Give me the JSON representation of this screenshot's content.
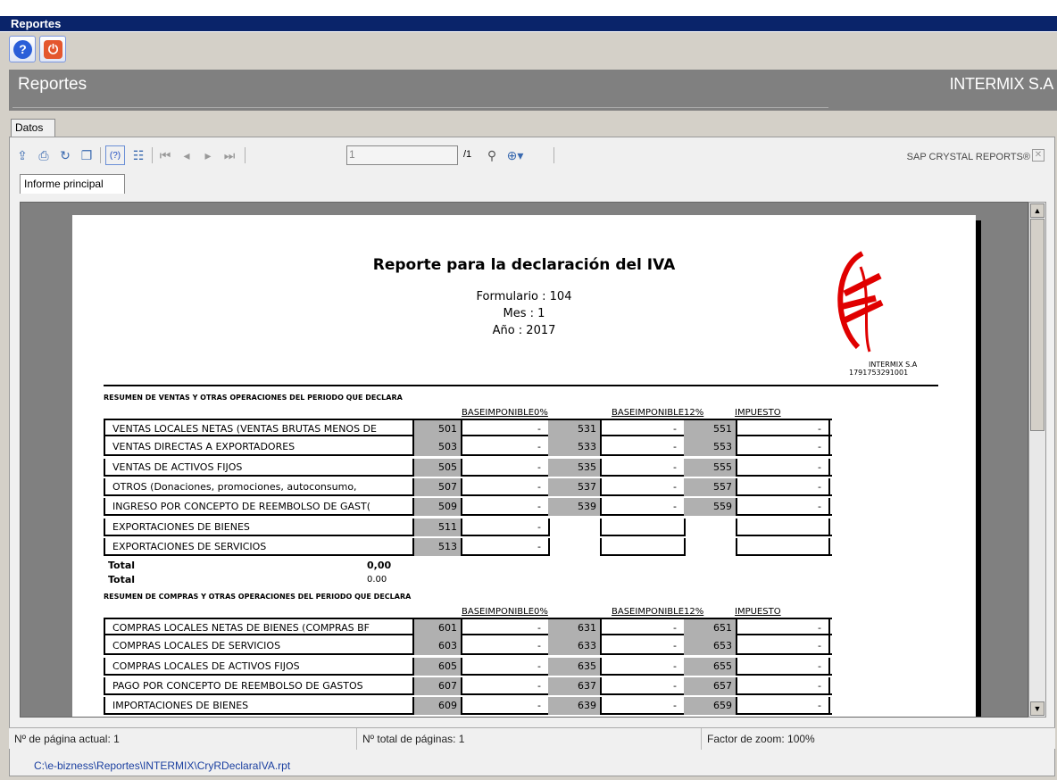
{
  "window": {
    "title": "Reportes"
  },
  "header": {
    "title": "Reportes",
    "company": "INTERMIX S.A"
  },
  "tabs": {
    "datos": "Datos",
    "main_report": "Informe principal"
  },
  "toolbar": {
    "page_value": "1",
    "page_total": "/1",
    "brand": "SAP CRYSTAL REPORTS®",
    "icons": [
      "export-icon",
      "print-icon",
      "refresh-icon",
      "copy-icon",
      "help-icon",
      "group-tree-icon",
      "first-page-icon",
      "prev-page-icon",
      "next-page-icon",
      "last-page-icon",
      "search-icon",
      "zoom-icon"
    ]
  },
  "report": {
    "title": "Reporte para la declaración del IVA",
    "form": "Formulario : 104",
    "month": "Mes : 1",
    "year": "Año : 2017",
    "logo_company": "INTERMIX S.A",
    "logo_ruc": "1791753291001",
    "sales_section": "RESUMEN DE VENTAS Y OTRAS OPERACIONES DEL PERIODO QUE DECLARA",
    "purchase_section": "RESUMEN DE COMPRAS Y OTRAS OPERACIONES DEL PERIODO QUE DECLARA",
    "col_base0": "BASEIMPONIBLE0%",
    "col_base12": "BASEIMPONIBLE12%",
    "col_tax": "IMPUESTO",
    "total_label_1": "Total",
    "total_value_1": "0,00",
    "total_label_2": "Total",
    "total_value_2": "0.00",
    "sales_rows": [
      {
        "label": "VENTAS LOCALES NETAS (VENTAS BRUTAS MENOS DE",
        "c1": "501",
        "v1": "-",
        "c2": "531",
        "v2": "-",
        "c3": "551",
        "v3": "-"
      },
      {
        "label": "VENTAS DIRECTAS A EXPORTADORES",
        "c1": "503",
        "v1": "-",
        "c2": "533",
        "v2": "-",
        "c3": "553",
        "v3": "-"
      },
      {
        "label": "VENTAS DE ACTIVOS FIJOS",
        "c1": "505",
        "v1": "-",
        "c2": "535",
        "v2": "-",
        "c3": "555",
        "v3": "-"
      },
      {
        "label": "OTROS (Donaciones, promociones, autoconsumo,",
        "c1": "507",
        "v1": "-",
        "c2": "537",
        "v2": "-",
        "c3": "557",
        "v3": "-"
      },
      {
        "label": "INGRESO POR CONCEPTO DE REEMBOLSO DE GAST(",
        "c1": "509",
        "v1": "-",
        "c2": "539",
        "v2": "-",
        "c3": "559",
        "v3": "-"
      },
      {
        "label": "EXPORTACIONES DE BIENES",
        "c1": "511",
        "v1": "-",
        "c2": "",
        "v2": "",
        "c3": "",
        "v3": ""
      },
      {
        "label": "EXPORTACIONES DE SERVICIOS",
        "c1": "513",
        "v1": "-",
        "c2": "",
        "v2": "",
        "c3": "",
        "v3": ""
      }
    ],
    "purchase_rows": [
      {
        "label": "COMPRAS LOCALES NETAS DE BIENES (COMPRAS BF",
        "c1": "601",
        "v1": "-",
        "c2": "631",
        "v2": "-",
        "c3": "651",
        "v3": "-"
      },
      {
        "label": "COMPRAS LOCALES DE SERVICIOS",
        "c1": "603",
        "v1": "-",
        "c2": "633",
        "v2": "-",
        "c3": "653",
        "v3": "-"
      },
      {
        "label": "COMPRAS LOCALES DE ACTIVOS FIJOS",
        "c1": "605",
        "v1": "-",
        "c2": "635",
        "v2": "-",
        "c3": "655",
        "v3": "-"
      },
      {
        "label": "PAGO POR CONCEPTO DE REEMBOLSO DE GASTOS",
        "c1": "607",
        "v1": "-",
        "c2": "637",
        "v2": "-",
        "c3": "657",
        "v3": "-"
      },
      {
        "label": "IMPORTACIONES DE BIENES",
        "c1": "609",
        "v1": "-",
        "c2": "639",
        "v2": "-",
        "c3": "659",
        "v3": "-"
      }
    ]
  },
  "status": {
    "current_page": "Nº de página actual: 1",
    "total_pages": "Nº total de páginas: 1",
    "zoom": "Factor de zoom: 100%"
  },
  "file_path": "C:\\e-bizness\\Reportes\\INTERMIX\\CryRDeclaraIVA.rpt",
  "colors": {
    "titlebar": "#0a246a",
    "header": "#808080",
    "logo": "#e00000"
  }
}
